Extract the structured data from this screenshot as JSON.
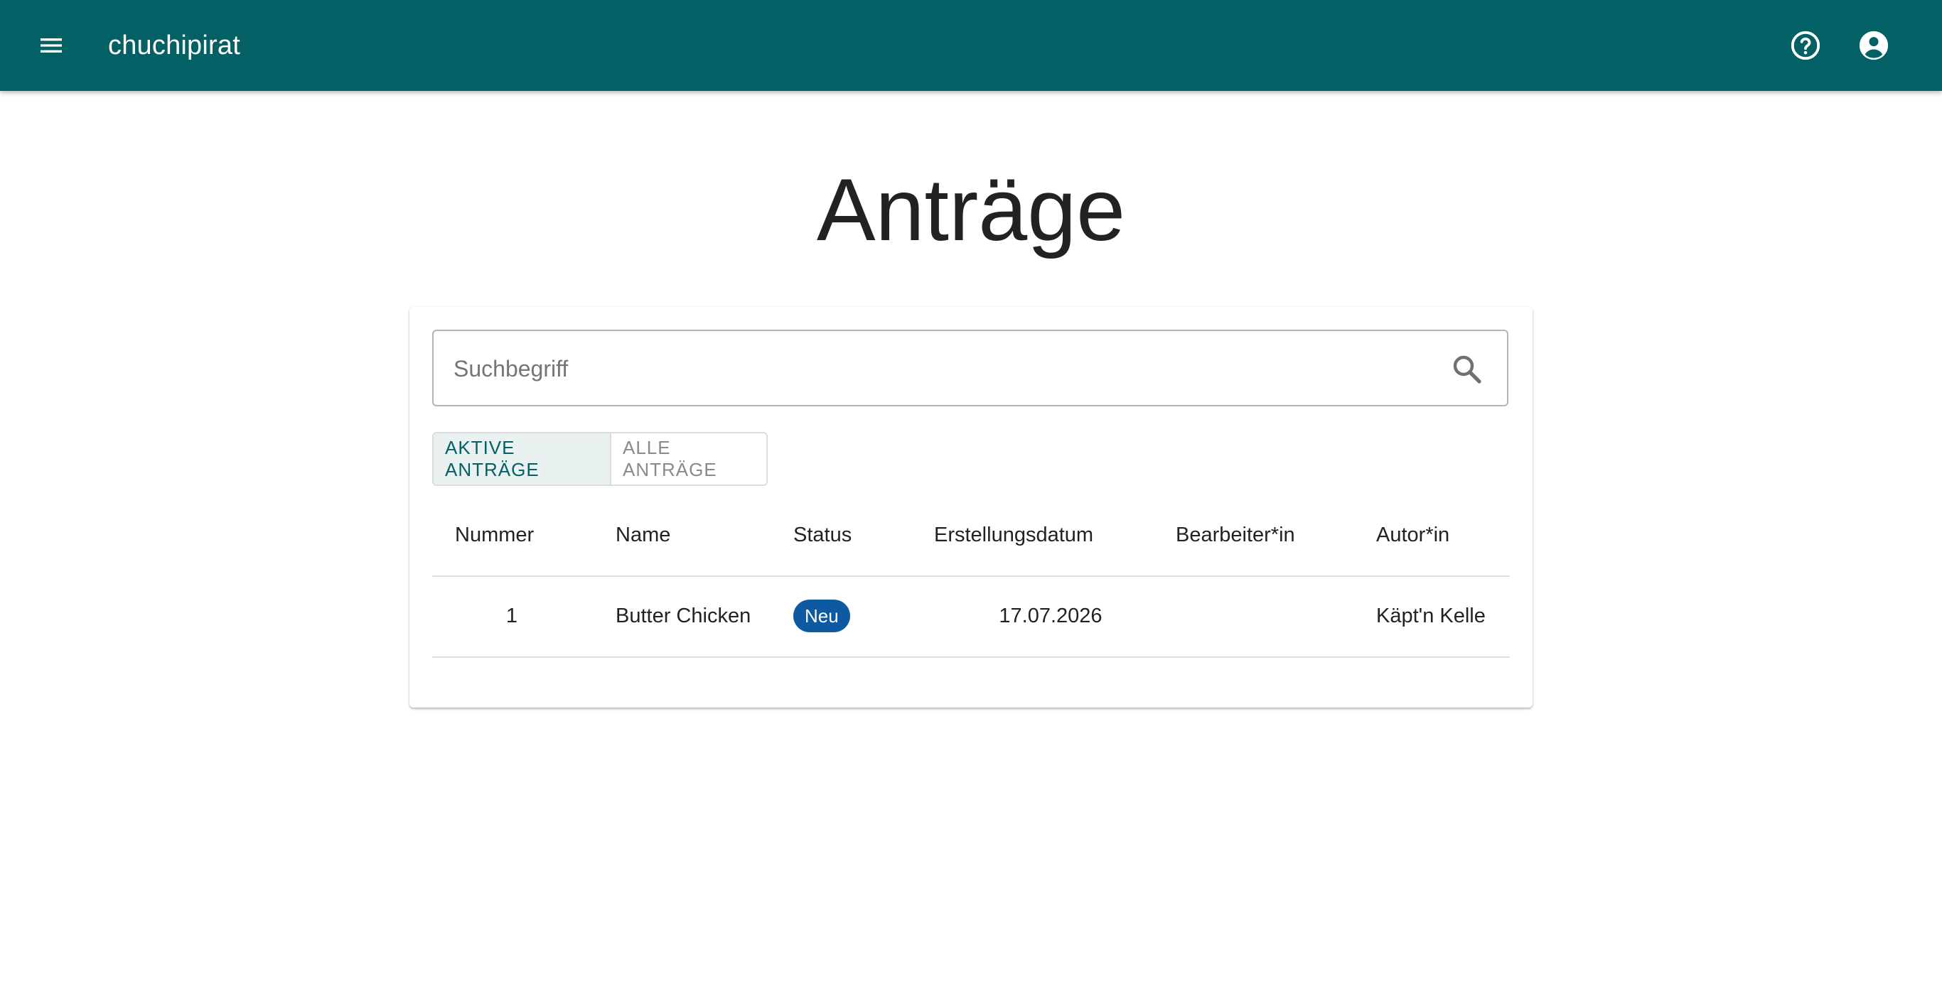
{
  "appbar": {
    "title": "chuchipirat",
    "menu_icon": "menu-icon",
    "help_icon": "help-icon",
    "account_icon": "account-circle-icon",
    "background_color": "#036166"
  },
  "page": {
    "title": "Anträge"
  },
  "search": {
    "placeholder": "Suchbegriff",
    "value": "",
    "icon": "search-icon"
  },
  "filter_toggle": {
    "options": [
      "AKTIVE ANTRÄGE",
      "ALLE ANTRÄGE"
    ],
    "selected": "AKTIVE ANTRÄGE"
  },
  "table": {
    "columns": [
      "Nummer",
      "Name",
      "Status",
      "Erstellungsdatum",
      "Bearbeiter*in",
      "Autor*in"
    ],
    "rows": [
      {
        "nummer": "1",
        "name": "Butter Chicken",
        "status": "Neu",
        "erstellungsdatum": "17.07.2026",
        "bearbeiter": "",
        "autor": "Käpt'n Kelle"
      }
    ]
  },
  "colors": {
    "primary": "#036166",
    "status_new": "#0e5aa2"
  }
}
